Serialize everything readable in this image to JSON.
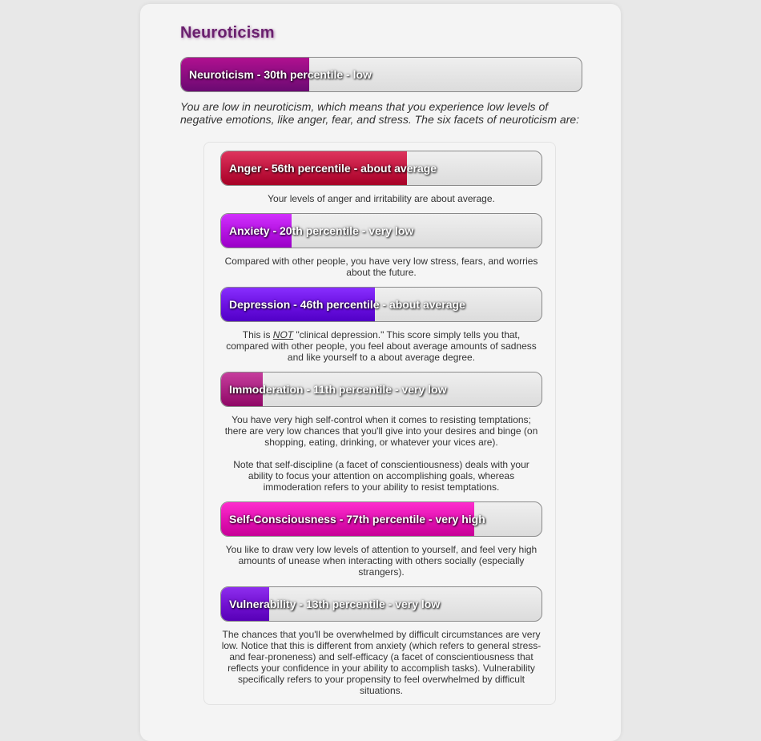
{
  "title": "Neuroticism",
  "main": {
    "label": "Neuroticism - 30th percentile - low",
    "percentile": 30,
    "color_start": "#b01090",
    "color_end": "#6a0a72"
  },
  "intro": "You are low in neuroticism, which means that you experience low levels of negative emotions, like anger, fear, and stress. The six facets of neuroticism are:",
  "facets": [
    {
      "label": "Anger - 56th percentile - about average",
      "percentile": 56,
      "color": "#c0163f",
      "desc": [
        "Your levels of anger and irritability are about average."
      ]
    },
    {
      "label": "Anxiety - 20th percentile - very low",
      "percentile": 20,
      "color": "#b312e0",
      "desc": [
        "Compared with other people, you have very low stress, fears, and worries about the future."
      ]
    },
    {
      "label": "Depression - 46th percentile - about average",
      "percentile": 46,
      "color": "#6a10e0",
      "desc_pre": "This is ",
      "desc_em": "NOT",
      "desc_post": " \"clinical depression.\" This score simply tells you that, compared with other people, you feel about average amounts of sadness and like yourself to a about average degree."
    },
    {
      "label": "Immoderation - 11th percentile - very low",
      "percentile": 11,
      "color": "#a8207f",
      "desc": [
        "You have very high self-control when it comes to resisting temptations; there are very low chances that you'll give into your desires and binge (on shopping, eating, drinking, or whatever your vices are).",
        "Note that self-discipline (a facet of conscientiousness) deals with your ability to focus your attention on accomplishing goals, whereas immoderation refers to your ability to resist temptations."
      ]
    },
    {
      "label": "Self-Consciousness - 77th percentile - very high",
      "percentile": 77,
      "color": "#e010b0",
      "desc": [
        "You like to draw very low levels of attention to yourself, and feel very high amounts of unease when interacting with others socially (especially strangers)."
      ]
    },
    {
      "label": "Vulnerability - 13th percentile - very low",
      "percentile": 13,
      "color": "#7010d0",
      "desc": [
        "The chances that you'll be overwhelmed by difficult circumstances are very low. Notice that this is different from anxiety (which refers to general stress- and fear-proneness) and self-efficacy (a facet of conscientiousness that reflects your confidence in your ability to accomplish tasks). Vulnerability specifically refers to your propensity to feel overwhelmed by difficult situations."
      ]
    }
  ]
}
